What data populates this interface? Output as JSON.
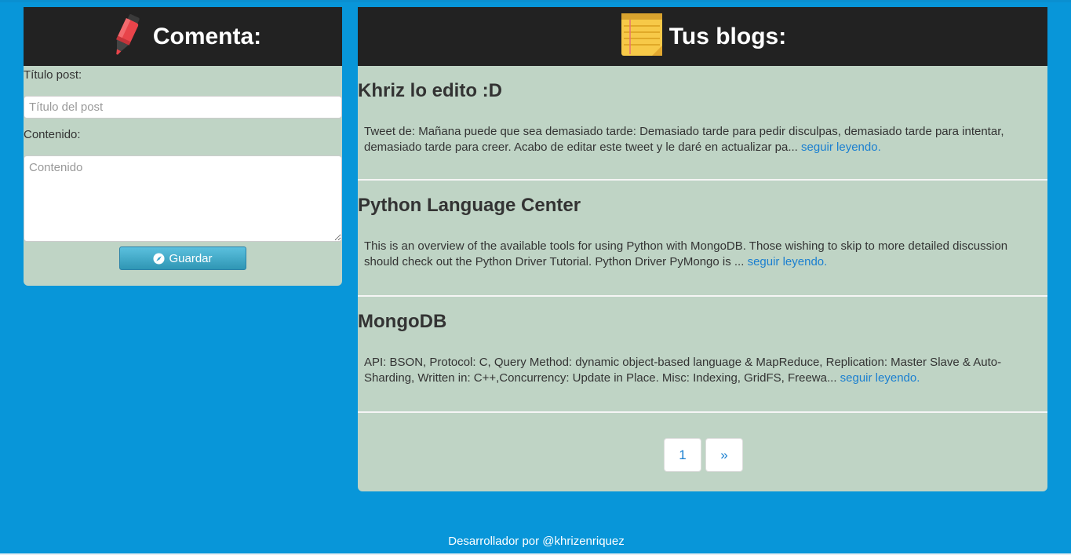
{
  "left": {
    "title": "Comenta:",
    "icon": "marker-icon",
    "title_label": "Título post:",
    "title_placeholder": "Título del post",
    "content_label": "Contenido:",
    "content_placeholder": "Contenido",
    "save_label": "Guardar",
    "save_icon": "compass-icon"
  },
  "right": {
    "title": "Tus blogs:",
    "icon": "notepad-icon",
    "posts": [
      {
        "title": "Khriz lo edito :D",
        "body": "Tweet de: Mañana puede que sea demasiado tarde: Demasiado tarde para pedir disculpas, demasiado tarde para intentar, demasiado tarde para creer. Acabo de editar este tweet y le daré en actualizar pa...",
        "link": "seguir leyendo."
      },
      {
        "title": "Python Language Center",
        "body": "This is an overview of the available tools for using Python with MongoDB. Those wishing to skip to more detailed discussion should check out the Python Driver Tutorial. Python Driver PyMongo is ...",
        "link": "seguir leyendo."
      },
      {
        "title": "MongoDB",
        "body": "API: BSON, Protocol: C, Query Method: dynamic object-based language & MapReduce, Replication: Master Slave & Auto-Sharding, Written in: C++,Concurrency: Update in Place. Misc: Indexing, GridFS, Freewa...",
        "link": "seguir leyendo."
      }
    ],
    "pagination": {
      "page": "1",
      "next": "»"
    }
  },
  "footer": "Desarrollador por @khrizenriquez",
  "colors": {
    "background": "#0896d9",
    "panel": "#bfd4c5",
    "header": "#222222",
    "link": "#1a7fd0"
  }
}
